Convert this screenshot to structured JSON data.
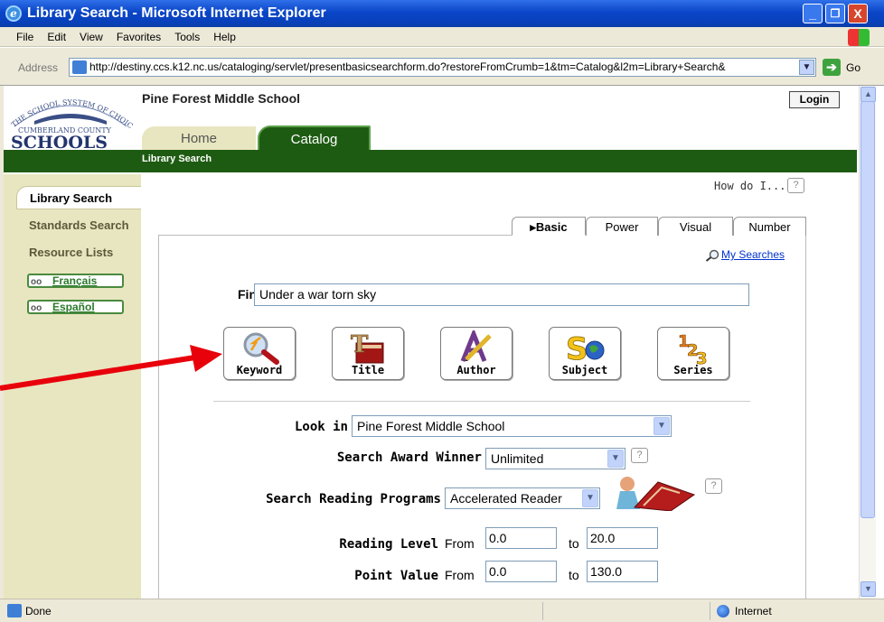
{
  "window": {
    "title": "Library Search - Microsoft Internet Explorer",
    "minimize": "_",
    "maximize": "❐",
    "close": "X"
  },
  "menu": [
    "File",
    "Edit",
    "View",
    "Favorites",
    "Tools",
    "Help"
  ],
  "address": {
    "label": "Address",
    "url": "http://destiny.ccs.k12.nc.us/cataloging/servlet/presentbasicsearchform.do?restoreFromCrumb=1&tm=Catalog&l2m=Library+Search&",
    "go": "Go"
  },
  "header": {
    "logo_top": "THE SCHOOL SYSTEM OF CHOICE",
    "logo_mid": "CUMBERLAND COUNTY",
    "logo_main": "SCHOOLS",
    "school_name": "Pine Forest Middle School",
    "login": "Login",
    "tabs": [
      "Home",
      "Catalog"
    ],
    "breadcrumb": "Library Search"
  },
  "sidebar": {
    "selected": "Library Search",
    "items": [
      "Standards Search",
      "Resource Lists"
    ],
    "languages": [
      "Français",
      "Español"
    ]
  },
  "help": {
    "how_do_i": "How do I...",
    "q": "?"
  },
  "search_tabs": [
    "▸Basic",
    "Power",
    "Visual",
    "Number"
  ],
  "my_searches": "My Searches",
  "find": {
    "label": "Find",
    "value": "Under a war torn sky"
  },
  "search_buttons": [
    "Keyword",
    "Title",
    "Author",
    "Subject",
    "Series"
  ],
  "look_in": {
    "label": "Look in",
    "value": "Pine Forest Middle School"
  },
  "award": {
    "label": "Search Award Winner",
    "value": "Unlimited"
  },
  "programs": {
    "label": "Search Reading Programs",
    "value": "Accelerated Reader"
  },
  "reading_level": {
    "label": "Reading Level",
    "from_label": "From",
    "from": "0.0",
    "to_label": "to",
    "to": "20.0"
  },
  "point_value": {
    "label": "Point Value",
    "from_label": "From",
    "from": "0.0",
    "to_label": "to",
    "to": "130.0"
  },
  "status": {
    "text": "Done",
    "zone": "Internet"
  },
  "colors": {
    "title_blue": "#0a46c8",
    "nav_green": "#1e5b12",
    "sidebar_beige": "#e8e6c0",
    "arrow_red": "#e8000b"
  }
}
